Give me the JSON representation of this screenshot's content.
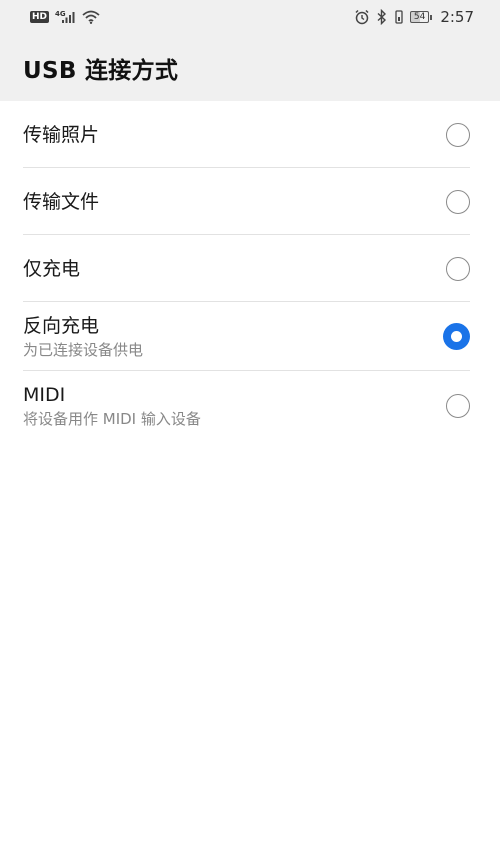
{
  "status_bar": {
    "hd_label": "HD",
    "network_type": "4G",
    "battery_level": "54",
    "time": "2:57"
  },
  "header": {
    "title": "USB 连接方式"
  },
  "options": [
    {
      "label": "传输照片",
      "subtitle": "",
      "selected": false
    },
    {
      "label": "传输文件",
      "subtitle": "",
      "selected": false
    },
    {
      "label": "仅充电",
      "subtitle": "",
      "selected": false
    },
    {
      "label": "反向充电",
      "subtitle": "为已连接设备供电",
      "selected": true
    },
    {
      "label": "MIDI",
      "subtitle": "将设备用作 MIDI 输入设备",
      "selected": false
    }
  ],
  "colors": {
    "accent": "#1a73e8",
    "header_bg": "#f0f0f0",
    "divider": "#e2e2e2"
  }
}
